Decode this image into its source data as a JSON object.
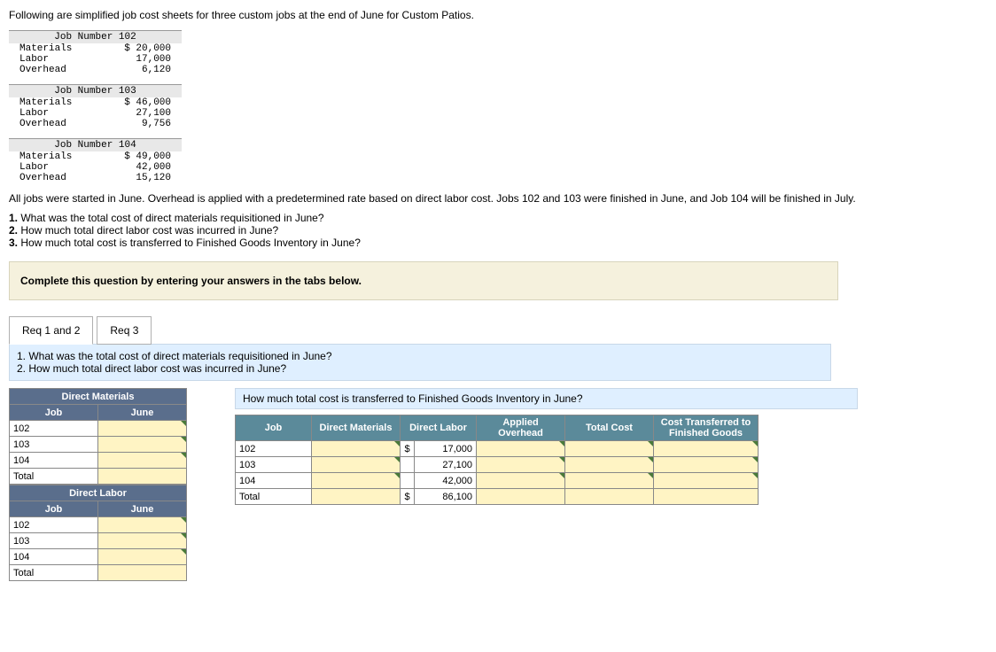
{
  "intro": "Following are simplified job cost sheets for three custom jobs at the end of June for Custom Patios.",
  "sheets": [
    {
      "header": "Job Number 102",
      "rows": [
        {
          "label": "Materials",
          "val": "$ 20,000"
        },
        {
          "label": "Labor",
          "val": "17,000"
        },
        {
          "label": "Overhead",
          "val": "6,120"
        }
      ]
    },
    {
      "header": "Job Number 103",
      "rows": [
        {
          "label": "Materials",
          "val": "$ 46,000"
        },
        {
          "label": "Labor",
          "val": "27,100"
        },
        {
          "label": "Overhead",
          "val": "9,756"
        }
      ]
    },
    {
      "header": "Job Number 104",
      "rows": [
        {
          "label": "Materials",
          "val": "$ 49,000"
        },
        {
          "label": "Labor",
          "val": "42,000"
        },
        {
          "label": "Overhead",
          "val": "15,120"
        }
      ]
    }
  ],
  "desc": "All jobs were started in June. Overhead is applied with a predetermined rate based on direct labor cost. Jobs 102 and 103 were finished in June, and Job 104 will be finished in July.",
  "q1n": "1.",
  "q1": " What was the total cost of direct materials requisitioned in June?",
  "q2n": "2.",
  "q2": " How much total direct labor cost was incurred in June?",
  "q3n": "3.",
  "q3": " How much total cost is transferred to Finished Goods Inventory in June?",
  "instr": "Complete this question by entering your answers in the tabs below.",
  "tab1": "Req 1 and 2",
  "tab2": "Req 3",
  "pane": "1. What was the total cost of direct materials requisitioned in June?\n2. How much total direct labor cost was incurred in June?",
  "dm": {
    "title": "Direct Materials",
    "col1": "Job",
    "col2": "June",
    "rows": [
      "102",
      "103",
      "104",
      "Total"
    ]
  },
  "dl": {
    "title": "Direct Labor",
    "col1": "Job",
    "col2": "June",
    "rows": [
      "102",
      "103",
      "104",
      "Total"
    ]
  },
  "fgq": "How much total cost is transferred to Finished Goods Inventory in June?",
  "fg": {
    "h": {
      "job": "Job",
      "dm": "Direct Materials",
      "dlab": "Direct Labor",
      "ao": "Applied Overhead",
      "tc": "Total Cost",
      "ct": "Cost Transferred to Finished Goods"
    },
    "rows": [
      {
        "job": "102",
        "sym": "$",
        "dl": "17,000"
      },
      {
        "job": "103",
        "sym": "",
        "dl": "27,100"
      },
      {
        "job": "104",
        "sym": "",
        "dl": "42,000"
      },
      {
        "job": "Total",
        "sym": "$",
        "dl": "86,100"
      }
    ]
  }
}
